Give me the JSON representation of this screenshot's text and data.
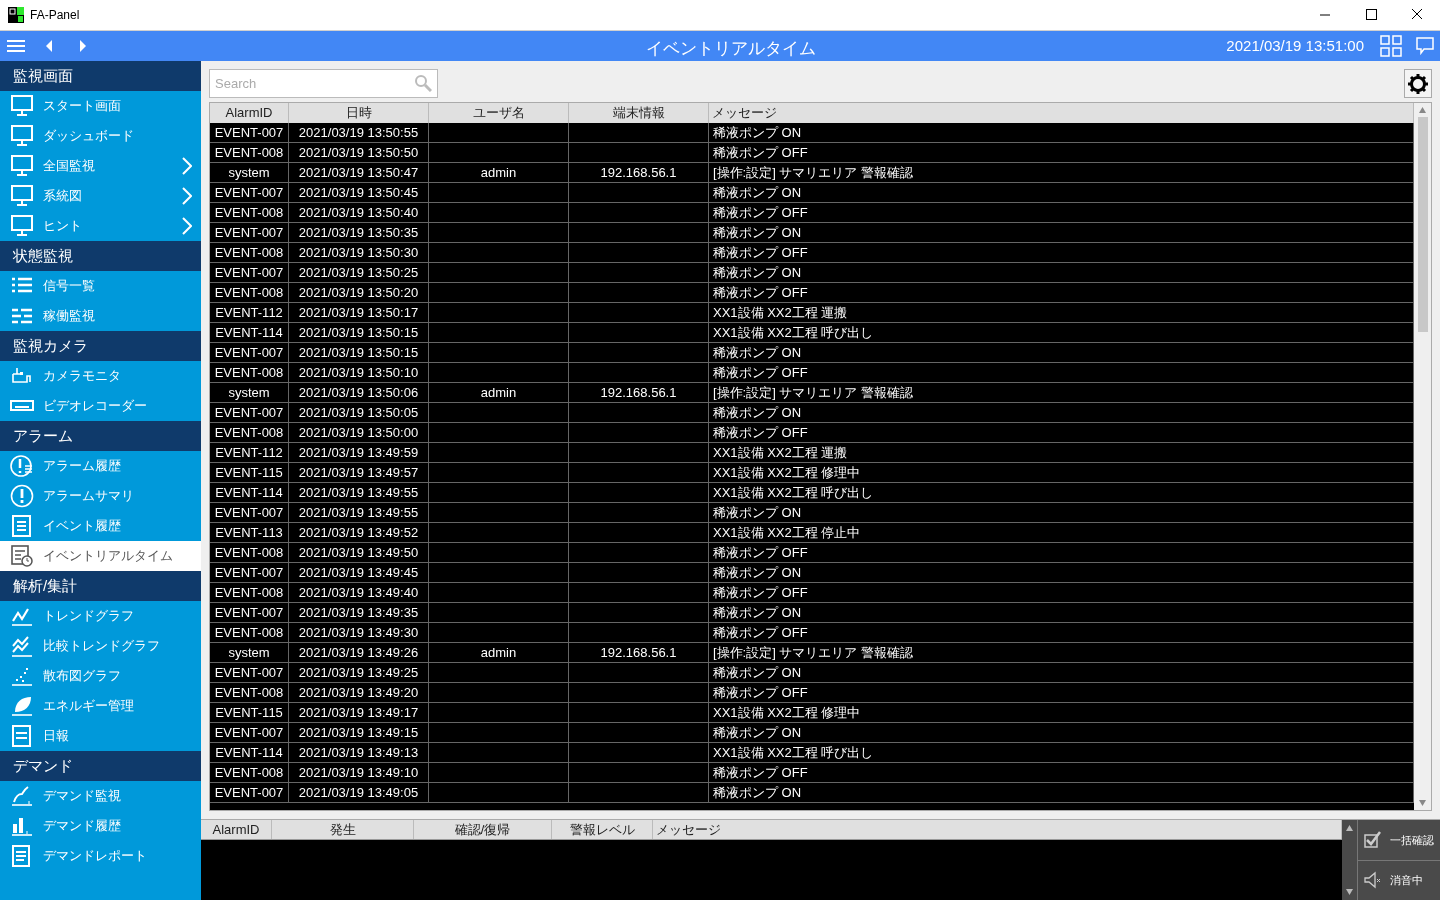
{
  "window": {
    "title": "FA-Panel"
  },
  "header": {
    "title": "イベントリアルタイム",
    "datetime": "2021/03/19 13:51:00"
  },
  "sidebar": {
    "items": [
      {
        "kind": "section",
        "label": "監視画面"
      },
      {
        "kind": "item",
        "label": "スタート画面",
        "selected": false,
        "chevron": false
      },
      {
        "kind": "item",
        "label": "ダッシュボード",
        "selected": false,
        "chevron": false
      },
      {
        "kind": "item",
        "label": "全国監視",
        "selected": false,
        "chevron": true
      },
      {
        "kind": "item",
        "label": "系統図",
        "selected": false,
        "chevron": true
      },
      {
        "kind": "item",
        "label": "ヒント",
        "selected": false,
        "chevron": true
      },
      {
        "kind": "section",
        "label": "状態監視"
      },
      {
        "kind": "item",
        "label": "信号一覧",
        "selected": false,
        "chevron": false
      },
      {
        "kind": "item",
        "label": "稼働監視",
        "selected": false,
        "chevron": false
      },
      {
        "kind": "section",
        "label": "監視カメラ"
      },
      {
        "kind": "item",
        "label": "カメラモニタ",
        "selected": false,
        "chevron": false
      },
      {
        "kind": "item",
        "label": "ビデオレコーダー",
        "selected": false,
        "chevron": false
      },
      {
        "kind": "section",
        "label": "アラーム"
      },
      {
        "kind": "item",
        "label": "アラーム履歴",
        "selected": false,
        "chevron": false
      },
      {
        "kind": "item",
        "label": "アラームサマリ",
        "selected": false,
        "chevron": false
      },
      {
        "kind": "item",
        "label": "イベント履歴",
        "selected": false,
        "chevron": false
      },
      {
        "kind": "item",
        "label": "イベントリアルタイム",
        "selected": true,
        "chevron": false
      },
      {
        "kind": "section",
        "label": "解析/集計"
      },
      {
        "kind": "item",
        "label": "トレンドグラフ",
        "selected": false,
        "chevron": false
      },
      {
        "kind": "item",
        "label": "比較トレンドグラフ",
        "selected": false,
        "chevron": false
      },
      {
        "kind": "item",
        "label": "散布図グラフ",
        "selected": false,
        "chevron": false
      },
      {
        "kind": "item",
        "label": "エネルギー管理",
        "selected": false,
        "chevron": false
      },
      {
        "kind": "item",
        "label": "日報",
        "selected": false,
        "chevron": false
      },
      {
        "kind": "section",
        "label": "デマンド"
      },
      {
        "kind": "item",
        "label": "デマンド監視",
        "selected": false,
        "chevron": false
      },
      {
        "kind": "item",
        "label": "デマンド履歴",
        "selected": false,
        "chevron": false
      },
      {
        "kind": "item",
        "label": "デマンドレポート",
        "selected": false,
        "chevron": false
      }
    ]
  },
  "search": {
    "placeholder": "Search"
  },
  "table": {
    "columns": [
      "AlarmID",
      "日時",
      "ユーザ名",
      "端末情報",
      "メッセージ"
    ],
    "rows": [
      [
        "EVENT-007",
        "2021/03/19 13:50:55",
        "",
        "",
        "稀液ポンプ ON"
      ],
      [
        "EVENT-008",
        "2021/03/19 13:50:50",
        "",
        "",
        "稀液ポンプ OFF"
      ],
      [
        "system",
        "2021/03/19 13:50:47",
        "admin",
        "192.168.56.1",
        "[操作:設定] サマリエリア 警報確認"
      ],
      [
        "EVENT-007",
        "2021/03/19 13:50:45",
        "",
        "",
        "稀液ポンプ ON"
      ],
      [
        "EVENT-008",
        "2021/03/19 13:50:40",
        "",
        "",
        "稀液ポンプ OFF"
      ],
      [
        "EVENT-007",
        "2021/03/19 13:50:35",
        "",
        "",
        "稀液ポンプ ON"
      ],
      [
        "EVENT-008",
        "2021/03/19 13:50:30",
        "",
        "",
        "稀液ポンプ OFF"
      ],
      [
        "EVENT-007",
        "2021/03/19 13:50:25",
        "",
        "",
        "稀液ポンプ ON"
      ],
      [
        "EVENT-008",
        "2021/03/19 13:50:20",
        "",
        "",
        "稀液ポンプ OFF"
      ],
      [
        "EVENT-112",
        "2021/03/19 13:50:17",
        "",
        "",
        "XX1設備 XX2工程 運搬"
      ],
      [
        "EVENT-114",
        "2021/03/19 13:50:15",
        "",
        "",
        "XX1設備 XX2工程 呼び出し"
      ],
      [
        "EVENT-007",
        "2021/03/19 13:50:15",
        "",
        "",
        "稀液ポンプ ON"
      ],
      [
        "EVENT-008",
        "2021/03/19 13:50:10",
        "",
        "",
        "稀液ポンプ OFF"
      ],
      [
        "system",
        "2021/03/19 13:50:06",
        "admin",
        "192.168.56.1",
        "[操作:設定] サマリエリア 警報確認"
      ],
      [
        "EVENT-007",
        "2021/03/19 13:50:05",
        "",
        "",
        "稀液ポンプ ON"
      ],
      [
        "EVENT-008",
        "2021/03/19 13:50:00",
        "",
        "",
        "稀液ポンプ OFF"
      ],
      [
        "EVENT-112",
        "2021/03/19 13:49:59",
        "",
        "",
        "XX1設備 XX2工程 運搬"
      ],
      [
        "EVENT-115",
        "2021/03/19 13:49:57",
        "",
        "",
        "XX1設備 XX2工程 修理中"
      ],
      [
        "EVENT-114",
        "2021/03/19 13:49:55",
        "",
        "",
        "XX1設備 XX2工程 呼び出し"
      ],
      [
        "EVENT-007",
        "2021/03/19 13:49:55",
        "",
        "",
        "稀液ポンプ ON"
      ],
      [
        "EVENT-113",
        "2021/03/19 13:49:52",
        "",
        "",
        "XX1設備 XX2工程 停止中"
      ],
      [
        "EVENT-008",
        "2021/03/19 13:49:50",
        "",
        "",
        "稀液ポンプ OFF"
      ],
      [
        "EVENT-007",
        "2021/03/19 13:49:45",
        "",
        "",
        "稀液ポンプ ON"
      ],
      [
        "EVENT-008",
        "2021/03/19 13:49:40",
        "",
        "",
        "稀液ポンプ OFF"
      ],
      [
        "EVENT-007",
        "2021/03/19 13:49:35",
        "",
        "",
        "稀液ポンプ ON"
      ],
      [
        "EVENT-008",
        "2021/03/19 13:49:30",
        "",
        "",
        "稀液ポンプ OFF"
      ],
      [
        "system",
        "2021/03/19 13:49:26",
        "admin",
        "192.168.56.1",
        "[操作:設定] サマリエリア 警報確認"
      ],
      [
        "EVENT-007",
        "2021/03/19 13:49:25",
        "",
        "",
        "稀液ポンプ ON"
      ],
      [
        "EVENT-008",
        "2021/03/19 13:49:20",
        "",
        "",
        "稀液ポンプ OFF"
      ],
      [
        "EVENT-115",
        "2021/03/19 13:49:17",
        "",
        "",
        "XX1設備 XX2工程 修理中"
      ],
      [
        "EVENT-007",
        "2021/03/19 13:49:15",
        "",
        "",
        "稀液ポンプ ON"
      ],
      [
        "EVENT-114",
        "2021/03/19 13:49:13",
        "",
        "",
        "XX1設備 XX2工程 呼び出し"
      ],
      [
        "EVENT-008",
        "2021/03/19 13:49:10",
        "",
        "",
        "稀液ポンプ OFF"
      ],
      [
        "EVENT-007",
        "2021/03/19 13:49:05",
        "",
        "",
        "稀液ポンプ ON"
      ]
    ]
  },
  "alarm_table": {
    "columns": [
      "AlarmID",
      "発生",
      "確認/復帰",
      "警報レベル",
      "メッセージ"
    ]
  },
  "actions": [
    "一括確認",
    "消音中"
  ]
}
